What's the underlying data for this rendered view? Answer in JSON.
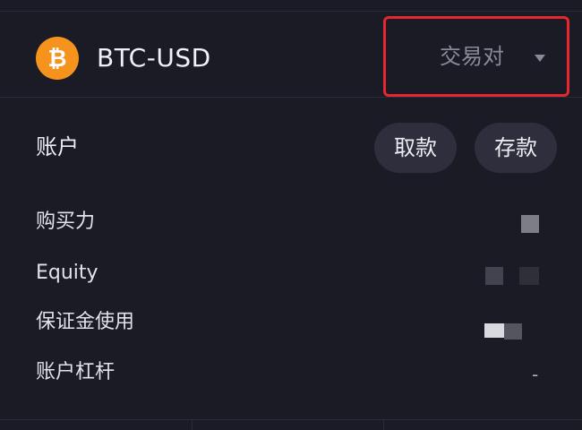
{
  "header": {
    "coin_symbol": "₿",
    "coin_icon": "bitcoin-icon",
    "market_name": "BTC-USD",
    "selector_label": "交易对",
    "selector_icon": "caret-down-icon"
  },
  "account": {
    "title": "账户",
    "withdraw_label": "取款",
    "deposit_label": "存款",
    "rows": [
      {
        "label": "购买力"
      },
      {
        "label": "Equity"
      },
      {
        "label": "保证金使用"
      },
      {
        "label": "账户杠杆",
        "value": "-"
      }
    ]
  },
  "colors": {
    "background": "#1b1b25",
    "bitcoin_orange": "#f5931d",
    "highlight_red": "#e6272e",
    "pill_bg": "#2e2e3d",
    "muted_text": "#8a8a97"
  }
}
